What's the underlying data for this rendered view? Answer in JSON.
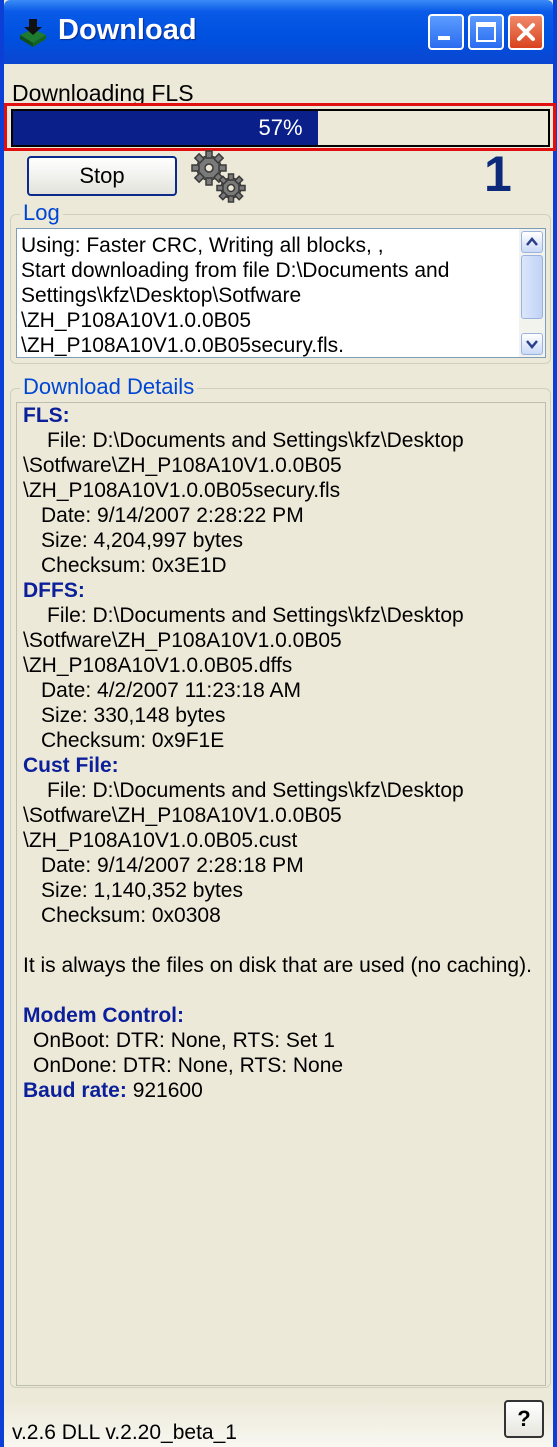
{
  "window": {
    "title": "Download",
    "icon": "download-app-icon",
    "controls": [
      "minimize-icon",
      "maximize-icon",
      "close-icon"
    ]
  },
  "status": {
    "label": "Downloading FLS"
  },
  "progress": {
    "percent": 57,
    "text": "57%",
    "fill_color": "#0a1f8a"
  },
  "toolbar": {
    "stop_label": "Stop",
    "icon": "gears-icon",
    "counter": "1"
  },
  "log": {
    "label": "Log",
    "lines": [
      "Using: Faster CRC, Writing all blocks, ,",
      "Start downloading from file D:\\Documents and",
      "Settings\\kfz\\Desktop\\Sotfware",
      "\\ZH_P108A10V1.0.0B05",
      "\\ZH_P108A10V1.0.0B05secury.fls."
    ]
  },
  "details": {
    "label": "Download Details",
    "fls": {
      "heading": "FLS:",
      "file_line1": "File: D:\\Documents and Settings\\kfz\\Desktop",
      "file_line2": "\\Sotfware\\ZH_P108A10V1.0.0B05",
      "file_line3": "\\ZH_P108A10V1.0.0B05secury.fls",
      "date": "Date: 9/14/2007 2:28:22 PM",
      "size": "Size: 4,204,997 bytes",
      "checksum": "Checksum: 0x3E1D"
    },
    "dffs": {
      "heading": "DFFS:",
      "file_line1": "File: D:\\Documents and Settings\\kfz\\Desktop",
      "file_line2": "\\Sotfware\\ZH_P108A10V1.0.0B05",
      "file_line3": "\\ZH_P108A10V1.0.0B05.dffs",
      "date": "Date: 4/2/2007 11:23:18 AM",
      "size": "Size: 330,148 bytes",
      "checksum": "Checksum: 0x9F1E"
    },
    "cust": {
      "heading": "Cust File:",
      "file_line1": "File: D:\\Documents and Settings\\kfz\\Desktop",
      "file_line2": "\\Sotfware\\ZH_P108A10V1.0.0B05",
      "file_line3": "\\ZH_P108A10V1.0.0B05.cust",
      "date": "Date: 9/14/2007 2:28:18 PM",
      "size": "Size: 1,140,352 bytes",
      "checksum": "Checksum: 0x0308"
    },
    "note": "It is always the files on disk that are used (no caching).",
    "modem": {
      "heading": "Modem Control:",
      "on_boot": "OnBoot: DTR: None, RTS: Set 1",
      "on_done": "OnDone: DTR: None, RTS: None"
    },
    "baud": {
      "label": "Baud rate:",
      "value": "921600"
    }
  },
  "footer": {
    "version": "v.2.6  DLL v.2.20_beta_1",
    "help_label": "?"
  }
}
